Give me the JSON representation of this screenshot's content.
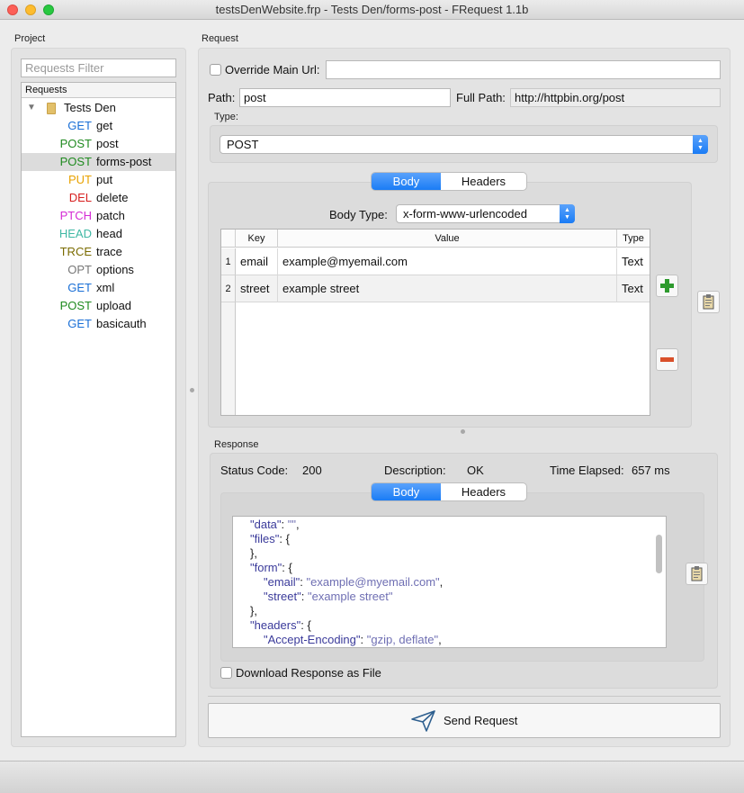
{
  "window": {
    "title": "testsDenWebsite.frp - Tests Den/forms-post - FRequest 1.1b"
  },
  "project": {
    "label": "Project",
    "filter_placeholder": "Requests Filter",
    "tree_header": "Requests",
    "folder": "Tests Den",
    "requests": [
      {
        "method": "GET",
        "name": "get",
        "color": "#1a6fd6"
      },
      {
        "method": "POST",
        "name": "post",
        "color": "#1f8a1f"
      },
      {
        "method": "POST",
        "name": "forms-post",
        "color": "#1f8a1f",
        "selected": true
      },
      {
        "method": "PUT",
        "name": "put",
        "color": "#e8a200"
      },
      {
        "method": "DEL",
        "name": "delete",
        "color": "#d71f1f"
      },
      {
        "method": "PTCH",
        "name": "patch",
        "color": "#d42bd4"
      },
      {
        "method": "HEAD",
        "name": "head",
        "color": "#3fb8a4"
      },
      {
        "method": "TRCE",
        "name": "trace",
        "color": "#7a6b00"
      },
      {
        "method": "OPT",
        "name": "options",
        "color": "#777777"
      },
      {
        "method": "GET",
        "name": "xml",
        "color": "#1a6fd6"
      },
      {
        "method": "POST",
        "name": "upload",
        "color": "#1f8a1f"
      },
      {
        "method": "GET",
        "name": "basicauth",
        "color": "#1a6fd6"
      }
    ]
  },
  "request": {
    "label": "Request",
    "override_label": "Override Main Url:",
    "override_value": "",
    "path_label": "Path:",
    "path_value": "post",
    "full_path_label": "Full Path:",
    "full_path_value": "http://httpbin.org/post",
    "type_label": "Type:",
    "type_value": "POST",
    "tabs": {
      "body": "Body",
      "headers": "Headers"
    },
    "body_type_label": "Body Type:",
    "body_type_value": "x-form-www-urlencoded",
    "table": {
      "columns": [
        "Key",
        "Value",
        "Type"
      ],
      "rows": [
        {
          "num": "1",
          "key": "email",
          "value": "example@myemail.com",
          "type": "Text"
        },
        {
          "num": "2",
          "key": "street",
          "value": "example street",
          "type": "Text"
        }
      ]
    }
  },
  "response": {
    "label": "Response",
    "status_code_label": "Status Code:",
    "status_code": "200",
    "description_label": "Description:",
    "description": "OK",
    "time_label": "Time Elapsed:",
    "time": "657 ms",
    "tabs": {
      "body": "Body",
      "headers": "Headers"
    },
    "json_lines": [
      {
        "indent": 1,
        "key": "\"data\"",
        "value": "\"\"",
        "suffix": ","
      },
      {
        "indent": 1,
        "key": "\"files\"",
        "value": "",
        "suffix": "{"
      },
      {
        "indent": 1,
        "key": "",
        "value": "",
        "suffix": "},"
      },
      {
        "indent": 1,
        "key": "\"form\"",
        "value": "",
        "suffix": "{"
      },
      {
        "indent": 2,
        "key": "\"email\"",
        "value": "\"example@myemail.com\"",
        "suffix": ","
      },
      {
        "indent": 2,
        "key": "\"street\"",
        "value": "\"example street\"",
        "suffix": ""
      },
      {
        "indent": 1,
        "key": "",
        "value": "",
        "suffix": "},"
      },
      {
        "indent": 1,
        "key": "\"headers\"",
        "value": "",
        "suffix": "{"
      },
      {
        "indent": 2,
        "key": "\"Accept-Encoding\"",
        "value": "\"gzip, deflate\"",
        "suffix": ","
      }
    ],
    "download_label": "Download Response as File"
  },
  "send_label": "Send Request"
}
